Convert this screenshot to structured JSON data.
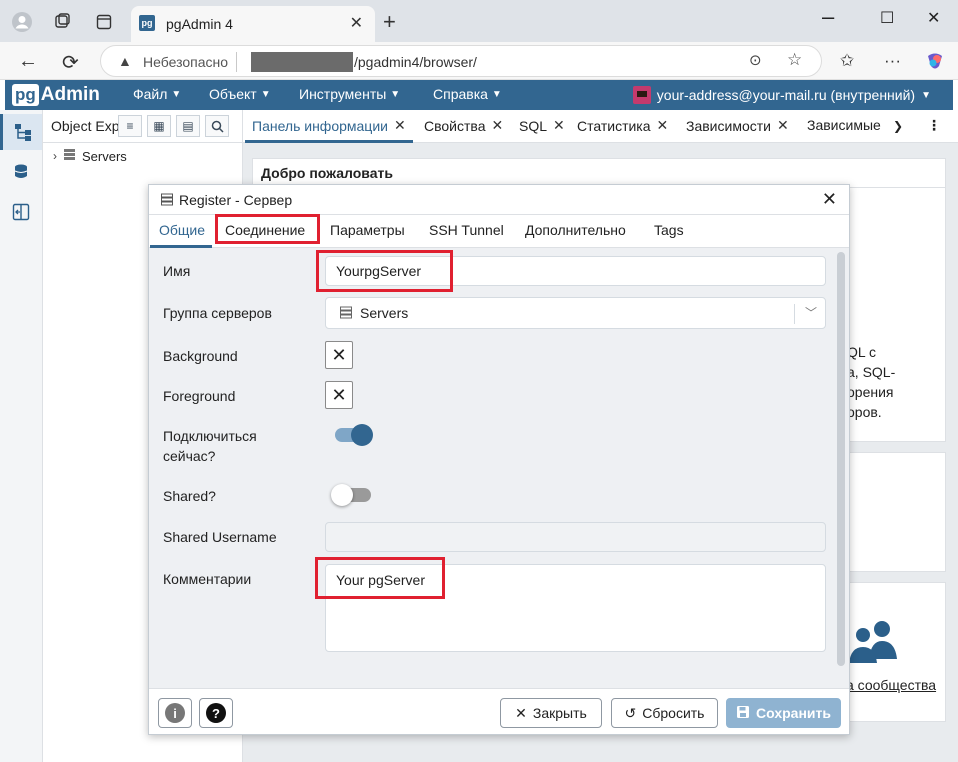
{
  "browser": {
    "tab_title": "pgAdmin 4",
    "favicon_text": "pg",
    "security_label": "Небезопасно",
    "url_path": "/pgadmin4/browser/"
  },
  "app": {
    "logo_pg": "pg",
    "logo_admin": "Admin",
    "menus": [
      "Файл",
      "Объект",
      "Инструменты",
      "Справка"
    ],
    "user": "your-address@your-mail.ru (внутренний)",
    "accent": "#326690"
  },
  "explorer": {
    "title": "Object Exp",
    "tree_root": "Servers"
  },
  "panel_tabs": [
    "Панель информации",
    "Свойства",
    "SQL",
    "Статистика",
    "Зависимости",
    "Зависимые"
  ],
  "welcome": {
    "title": "Добро пожаловать",
    "text_lines": [
      "QL с",
      "a, SQL-",
      "орения",
      "оров."
    ],
    "community_link": "а сообщества"
  },
  "dialog": {
    "title": "Register - Сервер",
    "tabs": [
      "Общие",
      "Соединение",
      "Параметры",
      "SSH Tunnel",
      "Дополнительно",
      "Tags"
    ],
    "fields": {
      "name_label": "Имя",
      "name_value": "YourpgServer",
      "group_label": "Группа серверов",
      "group_value": "Servers",
      "background_label": "Background",
      "foreground_label": "Foreground",
      "connect_label_1": "Подключиться",
      "connect_label_2": "сейчас?",
      "connect_now": true,
      "shared_label": "Shared?",
      "shared": false,
      "shared_username_label": "Shared Username",
      "shared_username_value": "",
      "comment_label": "Комментарии",
      "comment_value": "Your pgServer"
    },
    "buttons": {
      "close": "Закрыть",
      "reset": "Сбросить",
      "save": "Сохранить"
    }
  }
}
